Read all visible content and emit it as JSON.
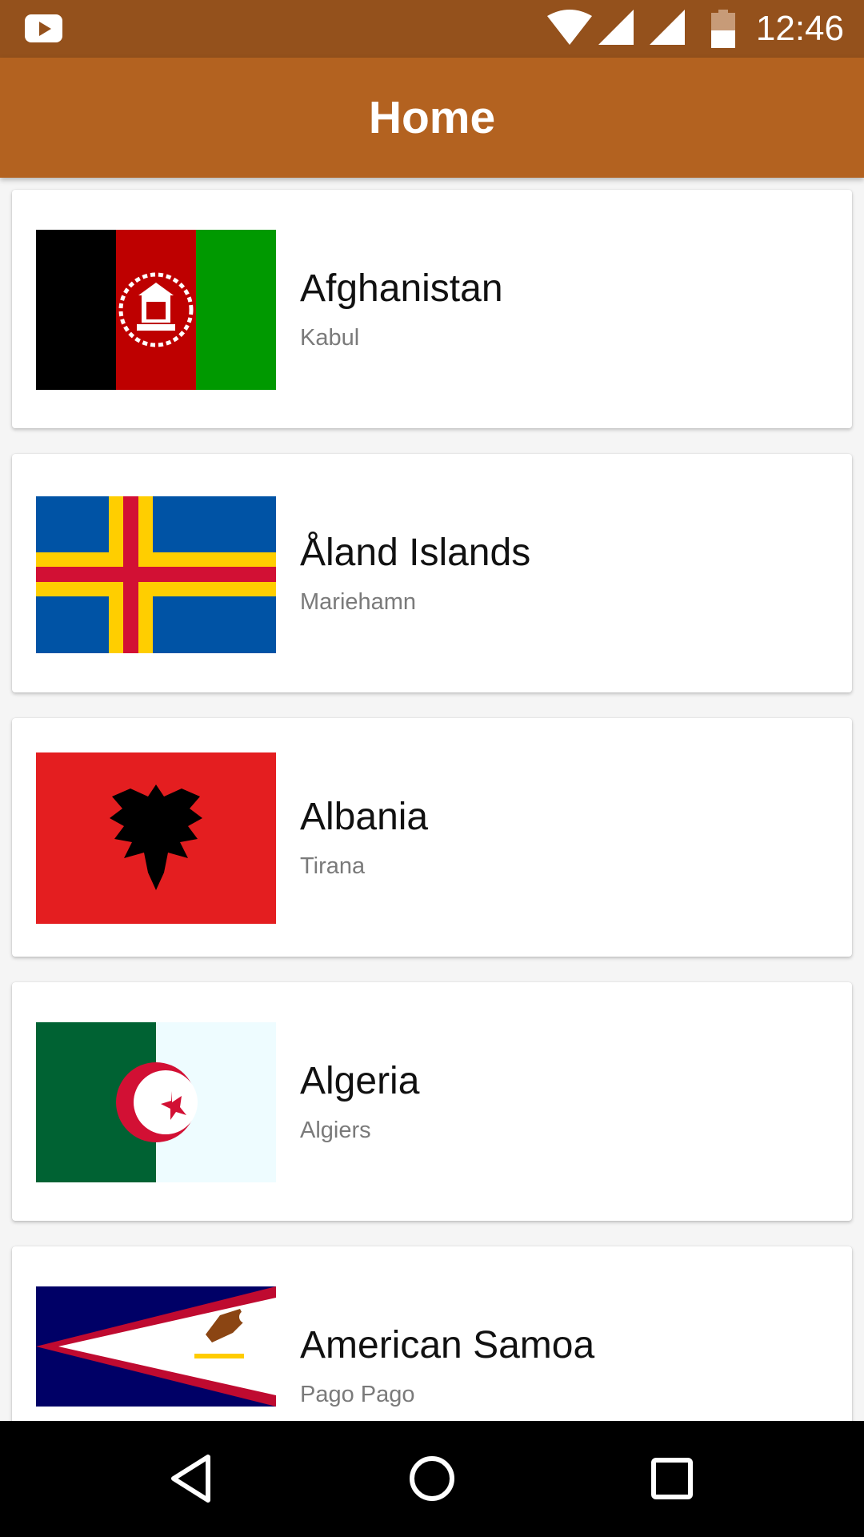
{
  "status_bar": {
    "time": "12:46",
    "icons": [
      "youtube-notification-icon",
      "wifi-icon",
      "cell-signal-icon",
      "cell-signal-icon",
      "battery-icon"
    ],
    "background": "#94511c"
  },
  "app_bar": {
    "title": "Home",
    "background": "#b36220"
  },
  "countries": [
    {
      "name": "Afghanistan",
      "capital": "Kabul",
      "flag_icon": "afghanistan-flag"
    },
    {
      "name": "Åland Islands",
      "capital": "Mariehamn",
      "flag_icon": "aland-islands-flag"
    },
    {
      "name": "Albania",
      "capital": "Tirana",
      "flag_icon": "albania-flag"
    },
    {
      "name": "Algeria",
      "capital": "Algiers",
      "flag_icon": "algeria-flag"
    },
    {
      "name": "American Samoa",
      "capital": "Pago Pago",
      "flag_icon": "american-samoa-flag"
    }
  ],
  "nav_bar": {
    "buttons": [
      "back-icon",
      "home-icon",
      "recents-icon"
    ]
  }
}
